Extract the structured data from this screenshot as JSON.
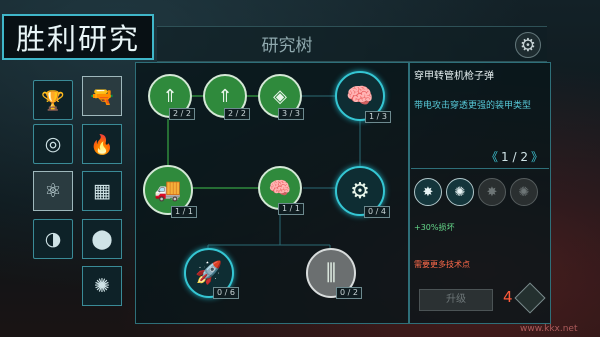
{
  "app": {
    "title": "胜利研究",
    "header_title": "研究树"
  },
  "categories": [
    {
      "id": "achievement",
      "icon": "🏆"
    },
    {
      "id": "bullets",
      "icon": "🔫"
    },
    {
      "id": "orbit",
      "icon": "◎"
    },
    {
      "id": "fire",
      "icon": "🔥"
    },
    {
      "id": "atom",
      "icon": "⚛"
    },
    {
      "id": "armor",
      "icon": "▦"
    },
    {
      "id": "shield",
      "icon": "◑"
    },
    {
      "id": "shell",
      "icon": "⬤"
    },
    {
      "id": "laser",
      "icon": "✺"
    }
  ],
  "nodes": [
    {
      "id": "bullet-1",
      "label": "2 / 2"
    },
    {
      "id": "bullet-2",
      "label": "2 / 2"
    },
    {
      "id": "bullet-3",
      "label": "3 / 3"
    },
    {
      "id": "brain-ammo",
      "label": "1 / 3"
    },
    {
      "id": "vehicle",
      "label": "1 / 1"
    },
    {
      "id": "brain",
      "label": "1 / 1"
    },
    {
      "id": "gears",
      "label": "0 / 4"
    },
    {
      "id": "missile",
      "label": "0 / 6"
    },
    {
      "id": "rounds",
      "label": "0 / 2"
    }
  ],
  "info": {
    "name": "穿甲转管机枪子弹",
    "description": "带电攻击穿透更强的装甲类型",
    "page": "1 / 2",
    "effect": "+30%损坏",
    "requirement": "需要更多技术点",
    "upgrade_label": "升级",
    "cost": "4"
  },
  "watermark": "www.kkx.net",
  "colors": {
    "accent": "#35c6d3",
    "researched": "#2f8a3c",
    "locked": "#6b6f70",
    "warning": "#ff5a3a"
  }
}
